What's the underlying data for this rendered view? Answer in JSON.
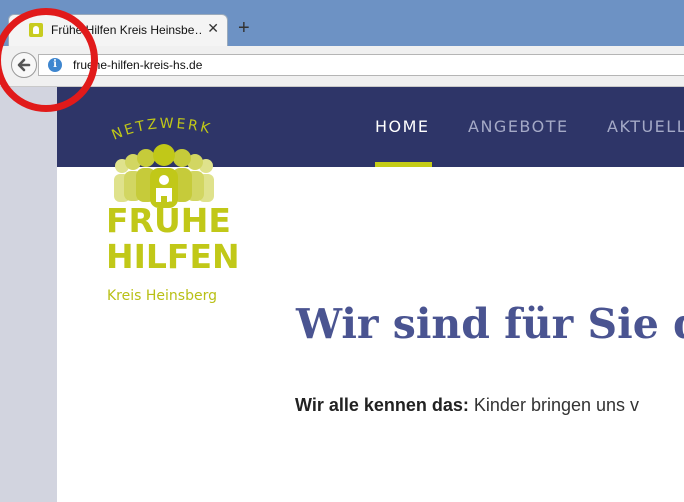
{
  "browser": {
    "tab_title": "Frühe Hilfen Kreis Heinsbe…",
    "url": "fruehe-hilfen-kreis-hs.de",
    "icons": {
      "back": "back-arrow-icon",
      "info": "info-icon",
      "close": "close-icon",
      "new_tab": "plus-icon"
    }
  },
  "site": {
    "nav": [
      "HOME",
      "ANGEBOTE",
      "AKTUELL"
    ],
    "active_nav": "HOME",
    "logo": {
      "arc_text": "NETZWERK",
      "brand_line1": "FRÜHE",
      "brand_line2": "HILFEN",
      "subtitle": "Kreis Heinsberg"
    },
    "headline": "Wir sind für Sie d",
    "intro_bold": "Wir alle kennen das:",
    "intro_text": " Kinder bringen uns v",
    "colors": {
      "header": "#2e3568",
      "accent": "#c5cc16",
      "headline": "#4a5491"
    }
  }
}
